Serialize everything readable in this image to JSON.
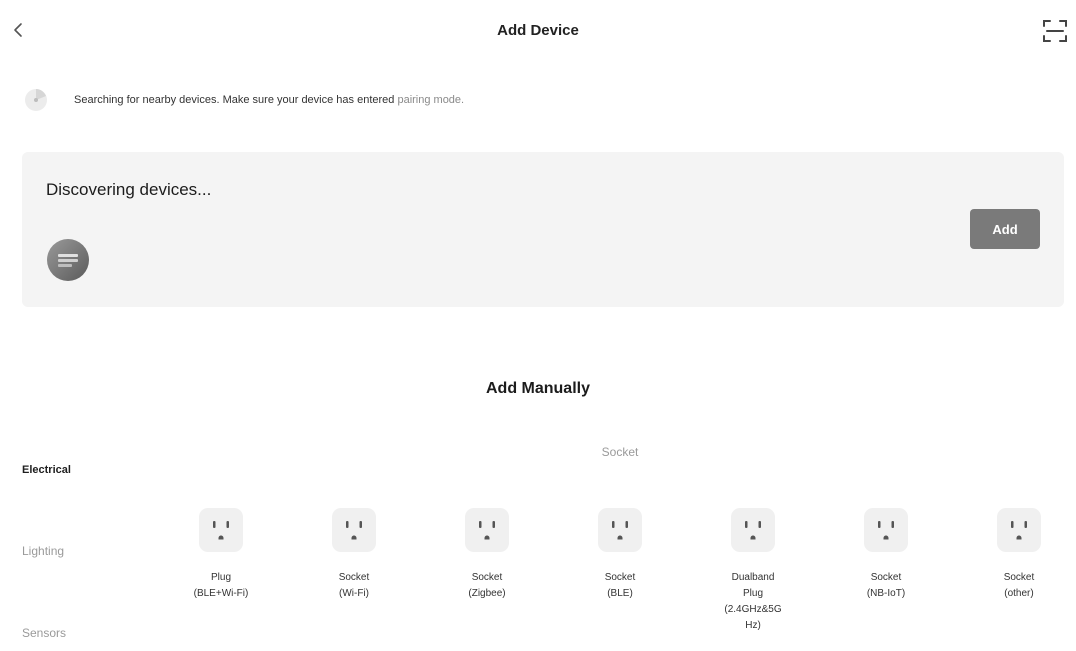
{
  "header": {
    "title": "Add Device"
  },
  "notice": {
    "text": "Searching for nearby devices. Make sure your device has entered ",
    "link": "pairing mode."
  },
  "discovery": {
    "title": "Discovering devices...",
    "add_label": "Add"
  },
  "manual": {
    "title": "Add Manually",
    "categories": [
      {
        "label": "Electrical",
        "active": true
      },
      {
        "label": "Lighting",
        "active": false
      },
      {
        "label": "Sensors",
        "active": false
      }
    ],
    "section_label": "Socket",
    "devices": [
      {
        "label": "Plug\n(BLE+Wi-Fi)",
        "icon": "socket-icon"
      },
      {
        "label": "Socket\n(Wi-Fi)",
        "icon": "socket-icon"
      },
      {
        "label": "Socket\n(Zigbee)",
        "icon": "socket-icon"
      },
      {
        "label": "Socket\n(BLE)",
        "icon": "socket-icon"
      },
      {
        "label": "Dualband\nPlug\n(2.4GHz&5G\nHz)",
        "icon": "socket-icon"
      },
      {
        "label": "Socket\n(NB-IoT)",
        "icon": "socket-icon"
      },
      {
        "label": "Socket\n(other)",
        "icon": "socket-icon"
      }
    ]
  },
  "colors": {
    "accent_button": "#7a7a7a",
    "card_background": "#f4f4f4",
    "muted_text": "#9a9a9a"
  }
}
